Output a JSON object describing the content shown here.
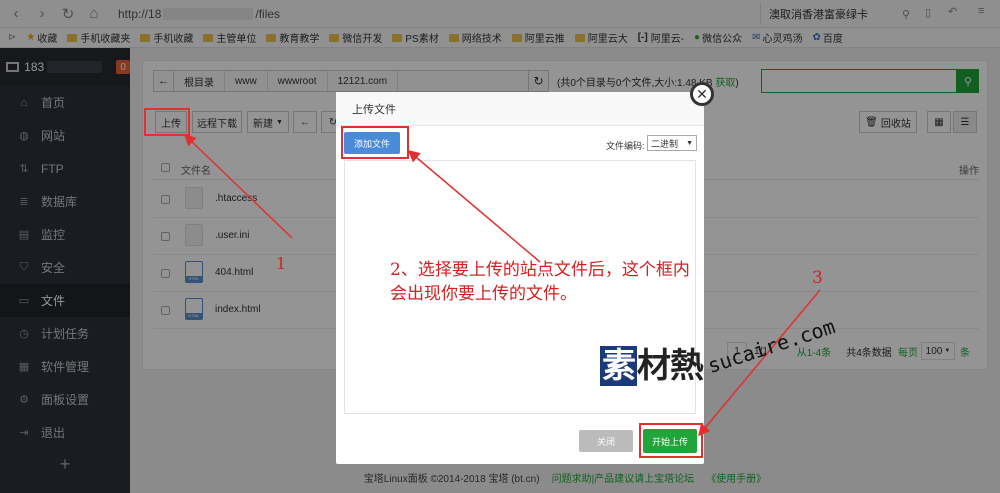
{
  "browser": {
    "url_prefix": "http://18",
    "url_suffix": "/files",
    "search_text": "澳取消香港富豪绿卡"
  },
  "bookmarks": [
    "收藏",
    "手机收藏夹",
    "手机收藏",
    "主管单位",
    "教育教学",
    "微信开发",
    "PS素材",
    "网络技术",
    "阿里云推",
    "阿里云大",
    "阿里云-",
    "微信公众",
    "心灵鸡汤",
    "百度"
  ],
  "sidebar": {
    "server_label": "183",
    "badge": "0",
    "items": [
      {
        "label": "首页",
        "icon": "home-icon"
      },
      {
        "label": "网站",
        "icon": "globe-icon"
      },
      {
        "label": "FTP",
        "icon": "ftp-icon"
      },
      {
        "label": "数据库",
        "icon": "database-icon"
      },
      {
        "label": "监控",
        "icon": "monitor-icon"
      },
      {
        "label": "安全",
        "icon": "shield-icon"
      },
      {
        "label": "文件",
        "icon": "folder-icon"
      },
      {
        "label": "计划任务",
        "icon": "clock-icon"
      },
      {
        "label": "软件管理",
        "icon": "grid-icon"
      },
      {
        "label": "面板设置",
        "icon": "gear-icon"
      },
      {
        "label": "退出",
        "icon": "logout-icon"
      }
    ],
    "active_index": 6,
    "add_symbol": "+"
  },
  "files": {
    "breadcrumbs": [
      "根目录",
      "www",
      "wwwroot",
      "12121.com"
    ],
    "stats_text": "(共0个目录与0个文件,大小:1.48 KB ",
    "stats_link": "获取",
    "stats_close": ")",
    "toolbar": {
      "upload": "上传",
      "remote_download": "远程下载",
      "new": "新建",
      "recycle_bin": "回收站"
    },
    "columns": {
      "name": "文件名",
      "actions": "操作"
    },
    "rows": [
      {
        "name": ".htaccess",
        "type": "file"
      },
      {
        "name": ".user.ini",
        "type": "file"
      },
      {
        "name": "404.html",
        "type": "html"
      },
      {
        "name": "index.html",
        "type": "html"
      }
    ],
    "pager": {
      "current": "1",
      "total": "1/1",
      "range": "从1-4条",
      "count": "共4条数据",
      "per_page_label": "每页",
      "per_page": "100",
      "unit": "条"
    }
  },
  "footer": {
    "copyright": "宝塔Linux面板 ©2014-2018 宝塔 (bt.cn)",
    "feedback": "问题求助|产品建议请上宝塔论坛",
    "manual": "《使用手册》"
  },
  "dialog": {
    "title": "上传文件",
    "add_file": "添加文件",
    "encoding_label": "文件编码:",
    "encoding_value": "二进制",
    "close": "关闭",
    "start_upload": "开始上传"
  },
  "annotations": {
    "num1": "1",
    "num3": "3",
    "instruction": "2、选择要上传的站点文件后，这个框内会出现你要上传的文件。"
  },
  "watermark": {
    "zh_1": "素",
    "zh_2": "材熱",
    "en": "sucaire.com"
  },
  "colors": {
    "accent": "#20a53a",
    "sidebar": "#2c3138",
    "highlight": "#e03030",
    "button_blue": "#4a8bd9"
  }
}
